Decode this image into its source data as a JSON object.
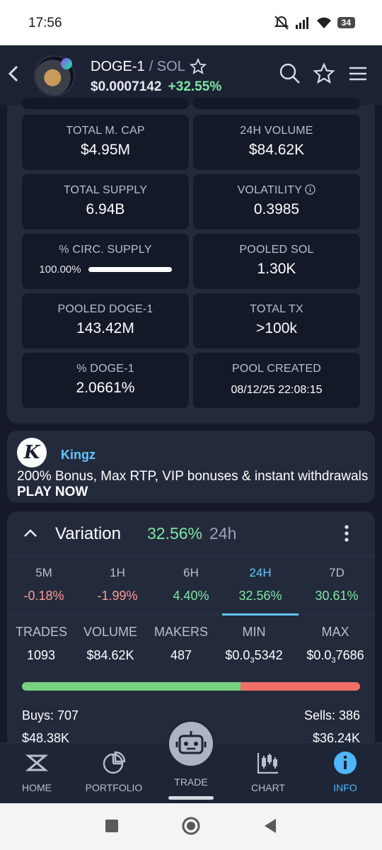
{
  "status_bar": {
    "time": "17:56",
    "battery": "34"
  },
  "header": {
    "base": "DOGE-1",
    "quote": "/ SOL",
    "price": "$0.0007142",
    "change": "+32.55%"
  },
  "stats": [
    {
      "label": "TOTAL M. CAP",
      "value": "$4.95M"
    },
    {
      "label": "24H VOLUME",
      "value": "$84.62K"
    },
    {
      "label": "TOTAL SUPPLY",
      "value": "6.94B"
    },
    {
      "label": "VOLATILITY",
      "value": "0.3985"
    },
    {
      "label": "% CIRC. SUPPLY",
      "value": "100.00%",
      "fraction": 1.0
    },
    {
      "label": "POOLED SOL",
      "value": "1.30K"
    },
    {
      "label": "POOLED DOGE-1",
      "value": "143.42M"
    },
    {
      "label": "TOTAL TX",
      "value": ">100k"
    },
    {
      "label": "% DOGE-1",
      "value": "2.0661%"
    },
    {
      "label": "POOL CREATED",
      "value": "08/12/25 22:08:15"
    }
  ],
  "ad": {
    "logo": "K",
    "title": "Kingz",
    "text": "200% Bonus, Max RTP, VIP bonuses & instant withdrawals",
    "cta": "PLAY NOW"
  },
  "variation": {
    "title": "Variation",
    "percent": "32.56%",
    "period": "24h",
    "tabs": [
      {
        "label": "5M",
        "value": "-0.18%",
        "trend": "neg"
      },
      {
        "label": "1H",
        "value": "-1.99%",
        "trend": "neg"
      },
      {
        "label": "6H",
        "value": "4.40%",
        "trend": "pos"
      },
      {
        "label": "24H",
        "value": "32.56%",
        "trend": "pos",
        "active": true
      },
      {
        "label": "7D",
        "value": "30.61%",
        "trend": "pos"
      }
    ],
    "metrics": [
      {
        "label": "TRADES",
        "value": "1093"
      },
      {
        "label": "VOLUME",
        "value": "$84.62K"
      },
      {
        "label": "MAKERS",
        "value": "487"
      },
      {
        "label": "MIN",
        "value": "$0.0",
        "sub": "3",
        "rest": "5342"
      },
      {
        "label": "MAX",
        "value": "$0.0",
        "sub": "3",
        "rest": "7686"
      }
    ],
    "buy_fraction": 0.647,
    "buys_count": "Buys: 707",
    "buys_volume": "$48.38K",
    "sells_count": "Sells: 386",
    "sells_volume": "$36.24K"
  },
  "nav": {
    "home": "HOME",
    "portfolio": "PORTFOLIO",
    "trade": "TRADE",
    "chart": "CHART",
    "info": "INFO"
  }
}
